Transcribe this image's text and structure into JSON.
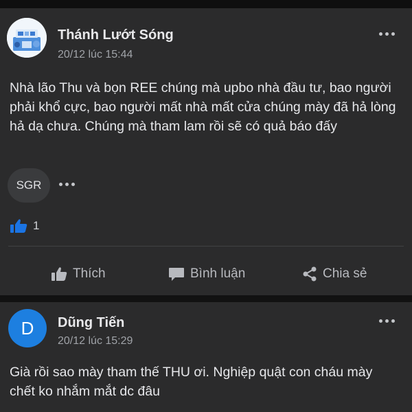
{
  "posts": [
    {
      "author": "Thánh Lướt Sóng",
      "time": "20/12 lúc 15:44",
      "text": "Nhà lão Thu và bọn REE chúng mà upbo nhà đầu tư, bao người phải khổ cực, bao người mất nhà mất cửa chúng mày đã hả lòng hả dạ chưa. Chúng mà tham lam rồi sẽ có quả báo đấy",
      "tag": "SGR",
      "like_count": "1",
      "actions": {
        "like": "Thích",
        "comment": "Bình luận",
        "share": "Chia sẻ"
      }
    },
    {
      "author": "Dũng Tiến",
      "avatar_letter": "D",
      "time": "20/12 lúc 15:29",
      "text": "Già rồi sao mày tham thế THU ơi. Nghiệp quật con cháu mày chết ko nhắm mắt dc đâu"
    }
  ],
  "colors": {
    "like_blue": "#1b74e4",
    "avatar_blue": "#1d7fe0",
    "card": "#2b2b2c"
  }
}
